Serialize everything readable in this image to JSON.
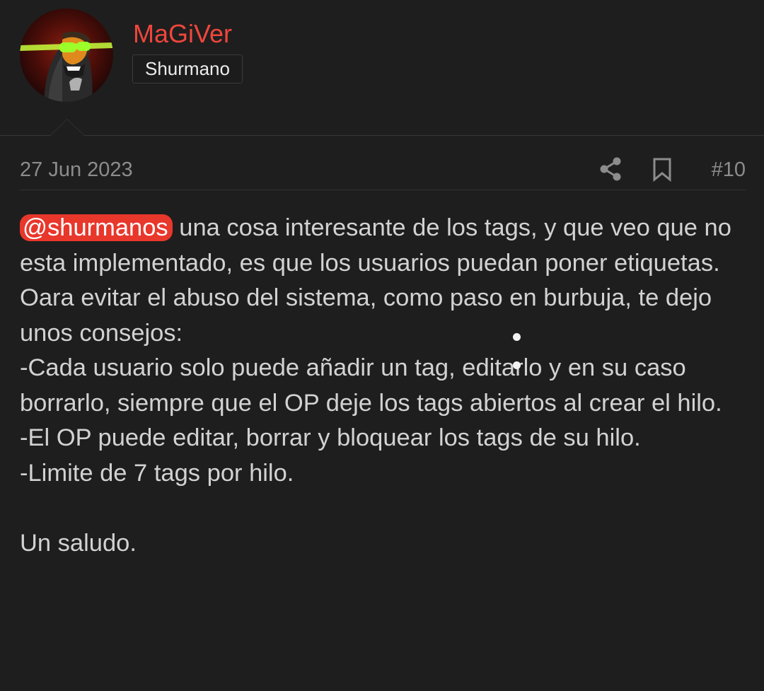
{
  "author": {
    "username": "MaGiVer",
    "user_title": "Shurmano",
    "avatar_icon": "avatar-icon"
  },
  "post": {
    "date": "27 Jun 2023",
    "number": "#10",
    "share_icon": "share-icon",
    "bookmark_icon": "bookmark-icon",
    "mention": "@shurmanos",
    "lines": [
      " una cosa interesante de los tags, y que veo que no esta implementado, es que los usuarios puedan poner etiquetas.",
      "Oara evitar el abuso del sistema, como paso en burbuja, te dejo unos consejos:",
      "-Cada usuario solo puede añadir un tag, editarlo y en su caso borrarlo, siempre que el OP deje los tags abiertos al crear el hilo.",
      "-El OP puede editar, borrar y bloquear los tags de su hilo.",
      "-Limite de 7 tags por hilo.",
      "",
      "Un saludo."
    ]
  },
  "colors": {
    "background": "#1e1e1e",
    "username": "#f0463c",
    "mention_bg": "#e8372b",
    "text": "#d2d2d2",
    "muted": "#8c8c8c"
  }
}
